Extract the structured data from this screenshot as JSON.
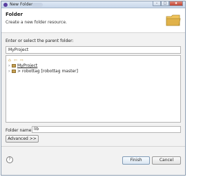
{
  "window": {
    "title": "New Folder",
    "close_glyph": "x"
  },
  "header": {
    "title": "Folder",
    "description": "Create a new folder resource."
  },
  "parent": {
    "label": "Enter or select the parent folder:",
    "value": "MyProject"
  },
  "tree": {
    "items": [
      {
        "label": "MyProject",
        "expanded": false
      },
      {
        "label": "> robottag [robottag master]",
        "expanded": false
      }
    ]
  },
  "folder_name": {
    "label": "Folder name:",
    "value": "lib"
  },
  "buttons": {
    "advanced": "Advanced >>",
    "finish": "Finish",
    "cancel": "Cancel",
    "help_glyph": "?"
  },
  "icons": {
    "app": "eclipse-icon",
    "banner": "folder-icon",
    "tree_toolbar": [
      "home-icon",
      "back-arrow-icon",
      "forward-arrow-icon"
    ],
    "project": "project-folder-icon",
    "help": "help-icon"
  },
  "colors": {
    "titlebar": "#c8d7ea",
    "close_button": "#c2412f",
    "folder_banner": "#e0b24a"
  }
}
